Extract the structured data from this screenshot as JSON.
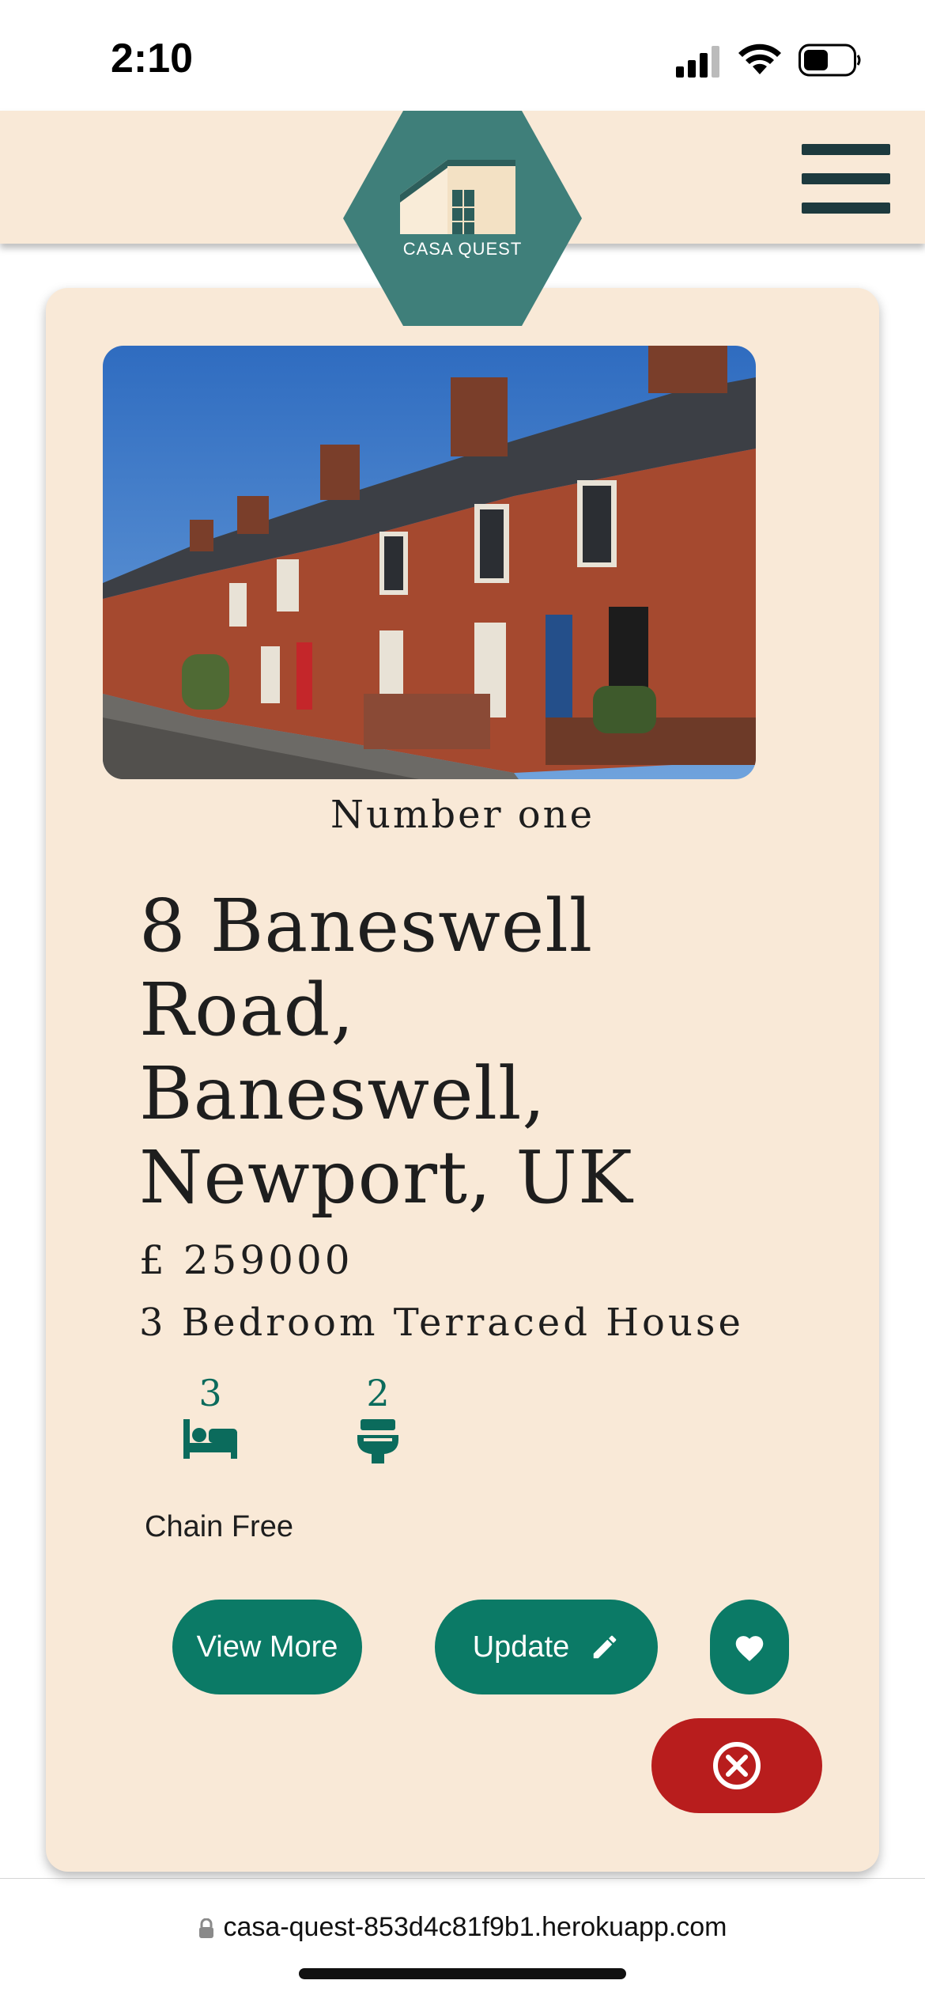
{
  "status_bar": {
    "time": "2:10"
  },
  "header": {
    "logo_text": "CASA QUEST",
    "logo_color": "#3f7f7a",
    "background_color": "#f9e9d7",
    "menu_icon": "hamburger-menu-icon"
  },
  "listing": {
    "name": "Number one",
    "address": "8 Baneswell Road, Baneswell, Newport, UK",
    "price": "£ 259000",
    "type": "3 Bedroom Terraced House",
    "bedrooms": "3",
    "bathrooms": "2",
    "chain_status": "Chain Free",
    "photo": "terraced-houses-photo"
  },
  "actions": {
    "view_more_label": "View More",
    "update_label": "Update",
    "favorite_icon": "heart-icon",
    "delete_icon": "close-circle-icon",
    "primary_color": "#0b7a66",
    "danger_color": "#b81d1d"
  },
  "browser": {
    "url": "casa-quest-853d4c81f9b1.herokuapp.com"
  }
}
